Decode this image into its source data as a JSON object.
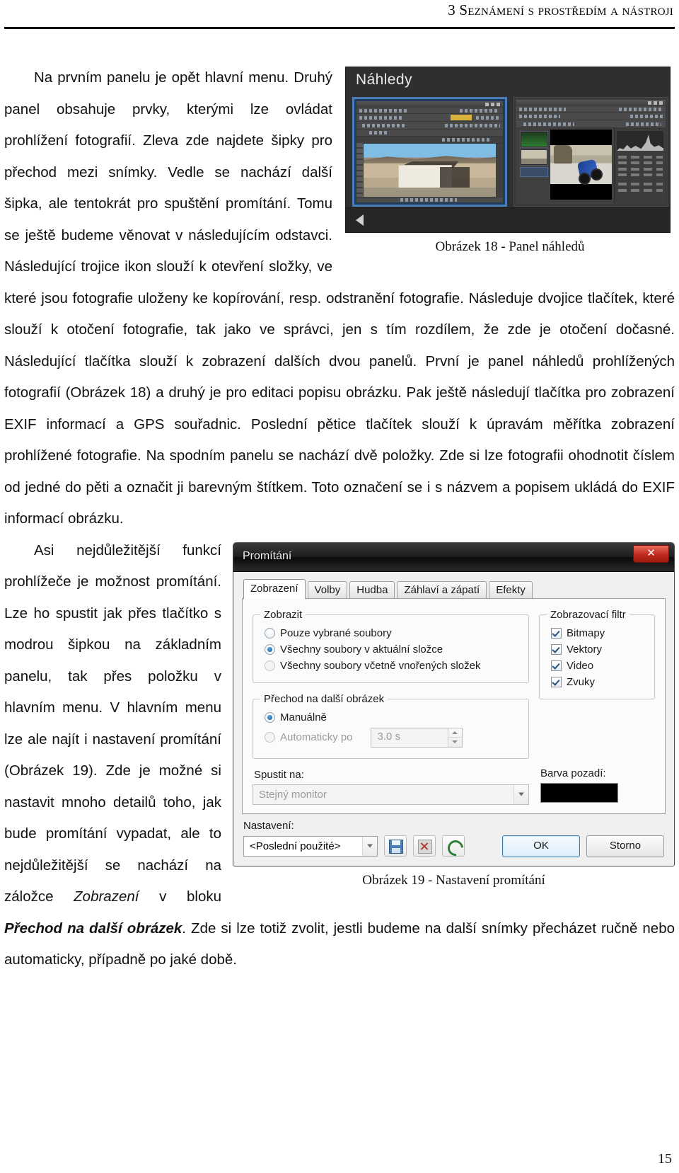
{
  "header": {
    "running_title": "3 Seznámení s prostředím a nástroji"
  },
  "page_number": "15",
  "paragraphs": {
    "p1": "Na prvním panelu je opět hlavní menu. Druhý panel obsahuje prvky, kterými lze ovládat prohlížení fotografií. Zleva zde najdete šipky pro přechod mezi snímky. Vedle se nachází další šipka, ale tentokrát pro spuštění promítání. Tomu se ještě budeme věnovat v následujícím odstavci. Následující trojice ikon slouží k otevření složky, ve které jsou fotografie uloženy ke kopírování, resp. odstranění fotografie. Následuje dvojice tlačítek, které slouží k otočení fotografie, tak jako ve správci, jen s tím rozdílem, že zde je otočení dočasné. Následující tlačítka slouží k zobrazení dalších dvou panelů. První je panel náhledů prohlížených fotografií (Obrázek 18) a druhý je pro editaci popisu obrázku. Pak ještě následují tlačítka pro zobrazení EXIF informací a GPS souřadnic. Poslední pětice tlačítek slouží k úpravám měřítka zobrazení prohlížené fotografie. Na spodním panelu se nachází dvě položky. Zde si lze fotografii ohodnotit číslem od jedné do pěti a označit ji barevným štítkem. Toto označení se i s názvem a popisem ukládá do EXIF informací obrázku.",
    "p2_run1": "Asi nejdůležitější funkcí prohlížeče je možnost promítání. Lze ho spustit jak přes tlačítko s modrou šipkou na základním panelu, tak přes položku v hlavním menu. V hlavním menu lze ale najít i nastavení promítání (Obrázek 19). Zde je možné si nastavit mnoho detailů toho, jak bude promítání vypadat, ale to nejdůležitější se nachází na záložce ",
    "p2_italic": "Zobrazení",
    "p2_run2": " v bloku ",
    "p2_bold_italic": "Přechod na další obrázek",
    "p2_run3": ". Zde si lze totiž zvolit, jestli budeme na další snímky přecházet ručně nebo automaticky, případně po jaké době."
  },
  "figure18": {
    "caption": "Obrázek 18 - Panel náhledů",
    "panel_title": "Náhledy",
    "scroll_left_icon": "triangle-left-icon",
    "thumbnails": [
      {
        "name": "thumbnail-house",
        "selected": true
      },
      {
        "name": "thumbnail-motorbike",
        "selected": false
      }
    ]
  },
  "figure19": {
    "caption": "Obrázek 19 - Nastavení promítání",
    "dialog_title": "Promítání",
    "close_label": "✕",
    "tabs": [
      {
        "label": "Zobrazení",
        "active": true
      },
      {
        "label": "Volby",
        "active": false
      },
      {
        "label": "Hudba",
        "active": false
      },
      {
        "label": "Záhlaví a zápatí",
        "active": false
      },
      {
        "label": "Efekty",
        "active": false
      }
    ],
    "group_display": {
      "legend": "Zobrazit",
      "options": [
        {
          "label": "Pouze vybrané soubory",
          "selected": false
        },
        {
          "label": "Všechny soubory v aktuální složce",
          "selected": true
        },
        {
          "label": "Všechny soubory včetně vnořených složek",
          "selected": false
        }
      ]
    },
    "group_transition": {
      "legend": "Přechod na další obrázek",
      "options": [
        {
          "label": "Manuálně",
          "selected": true
        },
        {
          "label": "Automaticky po",
          "selected": false
        }
      ],
      "interval_value": "3.0 s"
    },
    "run_on": {
      "label": "Spustit na:",
      "value": "Stejný monitor"
    },
    "display_filter": {
      "legend": "Zobrazovací filtr",
      "items": [
        {
          "label": "Bitmapy",
          "checked": true
        },
        {
          "label": "Vektory",
          "checked": true
        },
        {
          "label": "Video",
          "checked": true
        },
        {
          "label": "Zvuky",
          "checked": true
        }
      ]
    },
    "background_color": {
      "label": "Barva pozadí:",
      "value": "#000000"
    },
    "settings": {
      "label": "Nastavení:",
      "preset_value": "<Poslední použité>",
      "save_icon": "save-icon",
      "delete_icon": "delete-icon",
      "reset_icon": "undo-icon"
    },
    "buttons": {
      "ok": "OK",
      "cancel": "Storno"
    }
  }
}
